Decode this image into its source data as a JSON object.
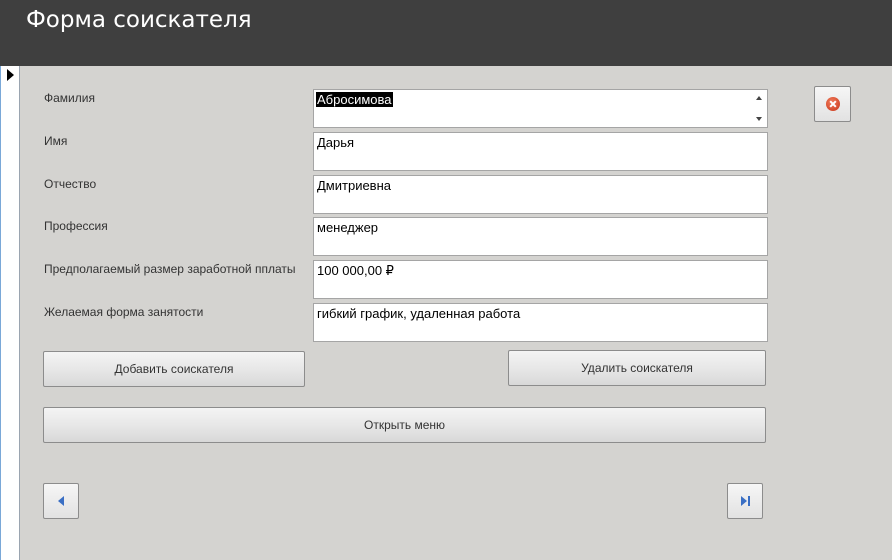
{
  "window": {
    "title": "Форма соискателя"
  },
  "fields": [
    {
      "label": "Фамилия",
      "value": "Абросимова"
    },
    {
      "label": "Имя",
      "value": "Дарья"
    },
    {
      "label": "Отчество",
      "value": "Дмитриевна"
    },
    {
      "label": "Профессия",
      "value": "менеджер"
    },
    {
      "label": "Предполагаемый размер заработной пплаты",
      "value": "100 000,00 ₽"
    },
    {
      "label": "Желаемая форма занятости",
      "value": "гибкий график, удаленная работа"
    }
  ],
  "buttons": {
    "add": "Добавить соискателя",
    "delete": "Удалить соискателя",
    "open_menu": "Открыть меню"
  },
  "icons": {
    "close": "close-icon",
    "prev": "previous-record-icon",
    "last": "last-record-icon",
    "record_selector": "record-selector-arrow-icon"
  },
  "colors": {
    "header": "#3f3f3f",
    "background": "#d4d3d0",
    "nav_icon": "#3a6fc4",
    "close_icon": "#c8361a"
  }
}
